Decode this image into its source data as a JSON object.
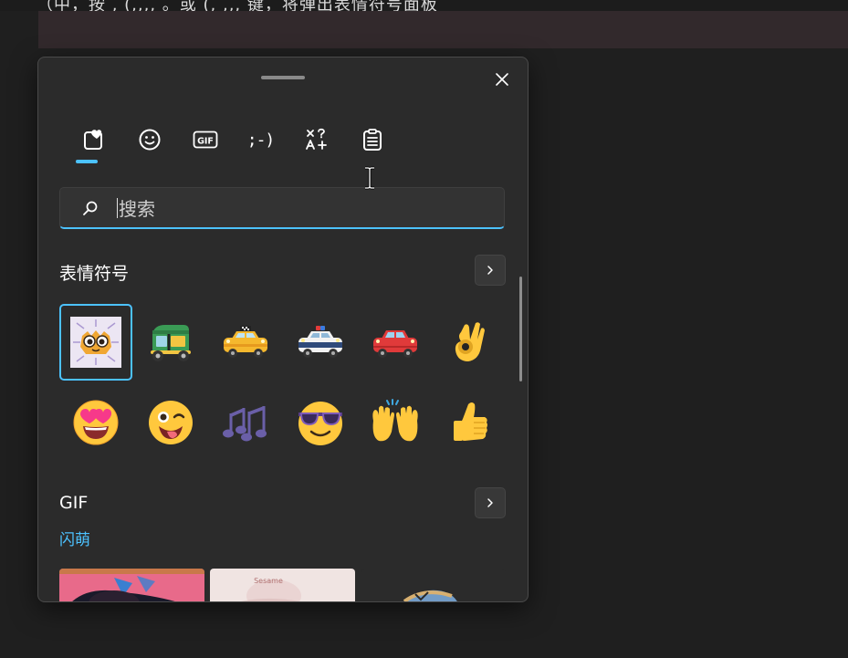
{
  "background": {
    "partial_text": "（中，按 , (,,,, 。或 (, ,,, 键，将弹出表情符号面板"
  },
  "panel": {
    "close_label": "✕",
    "tabs": [
      {
        "name": "favorites",
        "icon": "heart-clipboard-icon",
        "active": true
      },
      {
        "name": "emoji",
        "icon": "smiley-icon"
      },
      {
        "name": "gif",
        "icon": "gif-icon",
        "label": "GIF"
      },
      {
        "name": "kaomoji",
        "icon": "kaomoji-icon",
        "label": ";-)"
      },
      {
        "name": "symbols",
        "icon": "symbols-icon"
      },
      {
        "name": "clipboard",
        "icon": "clipboard-icon"
      }
    ],
    "search": {
      "placeholder": "搜索",
      "value": ""
    },
    "sections": {
      "emoji": {
        "title": "表情符号",
        "items": [
          {
            "label": "sticker",
            "char": ""
          },
          {
            "label": "auto rickshaw",
            "char": "🛺"
          },
          {
            "label": "oncoming taxi",
            "char": "🚖"
          },
          {
            "label": "police car",
            "char": "🚓"
          },
          {
            "label": "automobile",
            "char": "🚗"
          },
          {
            "label": "ok hand",
            "char": "👌"
          },
          {
            "label": "smiling face with heart-eyes",
            "char": "😍"
          },
          {
            "label": "winking face with tongue",
            "char": "😜"
          },
          {
            "label": "musical notes",
            "char": "🎶"
          },
          {
            "label": "smiling face with sunglasses",
            "char": "😎"
          },
          {
            "label": "raising hands",
            "char": "🙌"
          },
          {
            "label": "thumbs up",
            "char": "👍"
          }
        ]
      },
      "gif": {
        "title": "GIF",
        "subtitle": "闪萌",
        "thumb_text": "Sesame"
      }
    }
  },
  "colors": {
    "accent": "#4cc2ff",
    "panel_bg": "#2b2b2b",
    "page_bg": "#1f1f1f"
  }
}
